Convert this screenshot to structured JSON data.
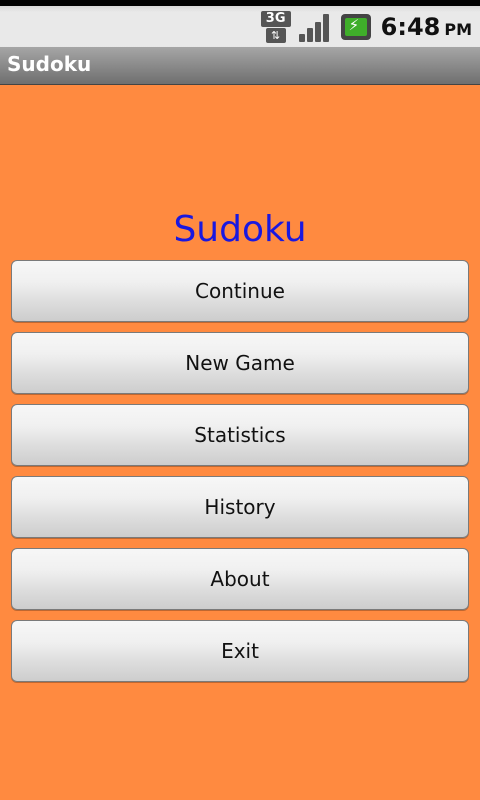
{
  "status_bar": {
    "network_label": "3G",
    "network_arrows": "⇅",
    "time": "6:48",
    "ampm": "PM",
    "colors": {
      "battery_fill": "#3fae2a"
    }
  },
  "title_bar": {
    "title": "Sudoku"
  },
  "main": {
    "heading": "Sudoku",
    "buttons": [
      {
        "label": "Continue"
      },
      {
        "label": "New Game"
      },
      {
        "label": "Statistics"
      },
      {
        "label": "History"
      },
      {
        "label": "About"
      },
      {
        "label": "Exit"
      }
    ]
  },
  "colors": {
    "background": "#ff8a40",
    "heading": "#1a18e0"
  }
}
